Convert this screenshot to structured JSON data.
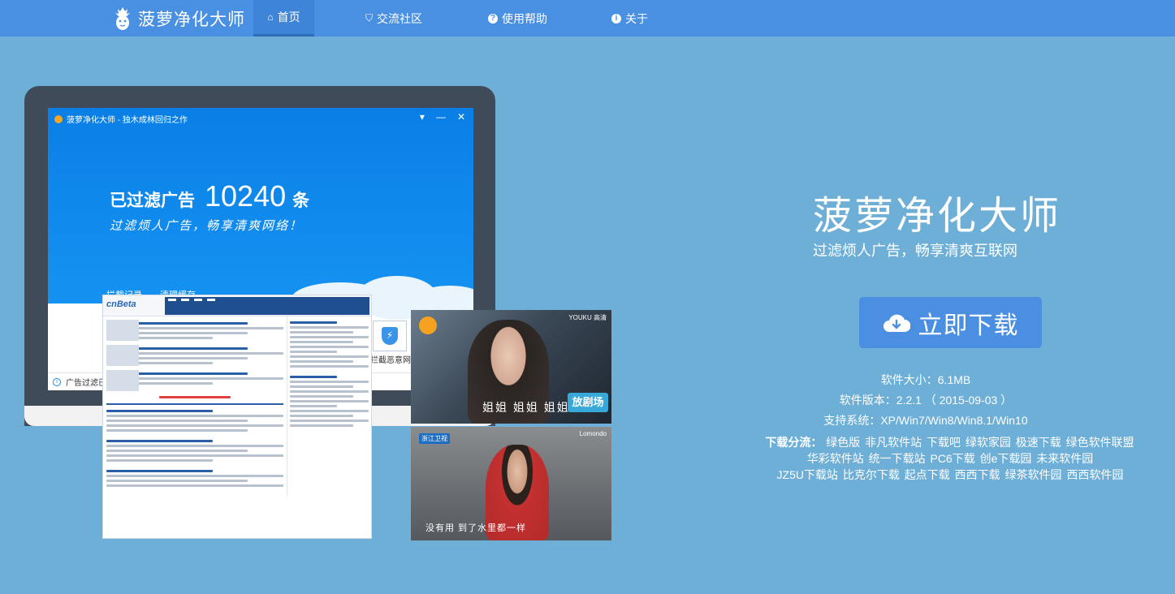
{
  "nav": {
    "brand": "菠萝净化大师",
    "items": [
      {
        "label": "首页",
        "icon": "home-icon"
      },
      {
        "label": "交流社区",
        "icon": "bookmark-icon"
      },
      {
        "label": "使用帮助",
        "icon": "question-icon"
      },
      {
        "label": "关于",
        "icon": "info-icon"
      }
    ]
  },
  "app": {
    "title": "菠萝净化大师 - 独木成林回归之作",
    "filtered_prefix": "已过滤广告",
    "filtered_count": "10240",
    "filtered_suffix": "条",
    "slogan": "过滤烦人广告，畅享清爽网络！",
    "tabs": [
      "拦截记录",
      "清理缓存"
    ],
    "status": "广告过滤已",
    "block_site": "拦截恶意网站"
  },
  "video1": {
    "subtitle": "姐姐  姐姐  姐姐",
    "watermark": "YOUKU\n高清",
    "badge": "放剧场"
  },
  "video2": {
    "subtitle": "没有用    到了水里都一样",
    "channel": "浙江卫视",
    "watermark": "Lomondo"
  },
  "hero": {
    "title": "菠萝净化大师",
    "subtitle": "过滤烦人广告，畅享清爽互联网",
    "download_label": "立即下载",
    "size": "软件大小：6.1MB",
    "version": "软件版本：2.2.1 （ 2015-09-03 ）",
    "system": "支持系统：XP/Win7/Win8/Win8.1/Win10",
    "dist_label": "下载分流：",
    "dist_links_line1": [
      "绿色版",
      "非凡软件站",
      "下载吧",
      "绿软家园",
      "极速下载",
      "绿色软件联盟"
    ],
    "dist_links_line2": [
      "华彩软件站",
      "统一下载站",
      "PC6下载",
      "创e下载园",
      "未来软件园"
    ],
    "dist_links_line3": [
      "JZ5U下载站",
      "比克尔下载",
      "起点下载",
      "西西下载",
      "绿茶软件园",
      "西西软件园"
    ]
  },
  "colors": {
    "nav_bg": "#4a90e2",
    "page_bg": "#6eafd8",
    "button_bg": "#4a8fe2",
    "app_blue": "#0a7fe6"
  }
}
